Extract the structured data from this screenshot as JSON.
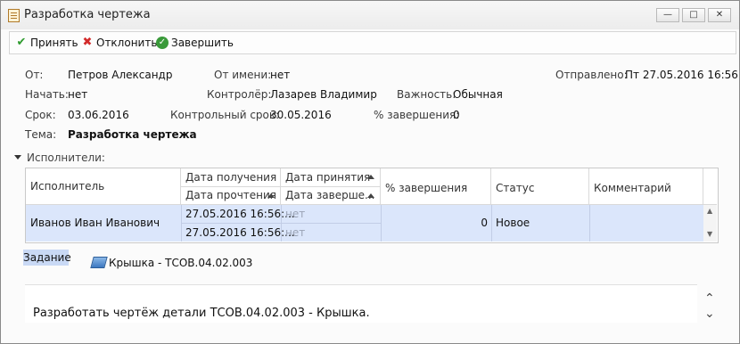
{
  "window": {
    "title": "Разработка чертежа"
  },
  "toolbar": {
    "accept_label": "Принять",
    "reject_label": "Отклонить",
    "complete_label": "Завершить"
  },
  "header": {
    "from_label": "От:",
    "from_value": "Петров Александр",
    "on_behalf_label": "От имени:",
    "on_behalf_value": "нет",
    "sent_label": "Отправлено:",
    "sent_value": "Пт 27.05.2016 16:56",
    "started_label": "Начать:",
    "started_value": "нет",
    "controller_label": "Контролёр:",
    "controller_value": "Лазарев Владимир",
    "importance_label": "Важность:",
    "importance_value": "Обычная",
    "due_label": "Срок:",
    "due_value": "03.06.2016",
    "control_due_label": "Контрольный срок:",
    "control_due_value": "30.05.2016",
    "percent_label": "% завершения:",
    "percent_value": "0",
    "subject_label": "Тема:",
    "subject_value": "Разработка чертежа"
  },
  "executors": {
    "section_label": "Исполнители:",
    "columns": {
      "executor": "Исполнитель",
      "received": "Дата получения",
      "read": "Дата прочтения",
      "accepted": "Дата принятия",
      "finished": "Дата заверше...",
      "percent": "% завершения",
      "status": "Статус",
      "comment": "Комментарий"
    },
    "rows": [
      {
        "executor": "Иванов Иван Иванович",
        "received": "27.05.2016 16:56:...",
        "read": "27.05.2016 16:56:...",
        "accepted": "нет",
        "finished": "нет",
        "percent": "0",
        "status": "Новое",
        "comment": ""
      }
    ]
  },
  "task": {
    "tab_label": "Задание",
    "attachment": "Крышка - ТСОВ.04.02.003",
    "description": "Разработать чертёж детали ТСОВ.04.02.003 - Крышка."
  },
  "icons": [
    "document-icon",
    "minimize-icon",
    "maximize-icon",
    "close-icon",
    "check-icon",
    "x-icon",
    "complete-icon",
    "collapse-triangle-icon",
    "part-icon",
    "chevron-up-icon",
    "chevron-down-icon"
  ],
  "colors": {
    "selection": "#dbe6fb",
    "accept": "#2e9b2e",
    "reject": "#d22a2a",
    "tab": "#c9d9f5"
  }
}
